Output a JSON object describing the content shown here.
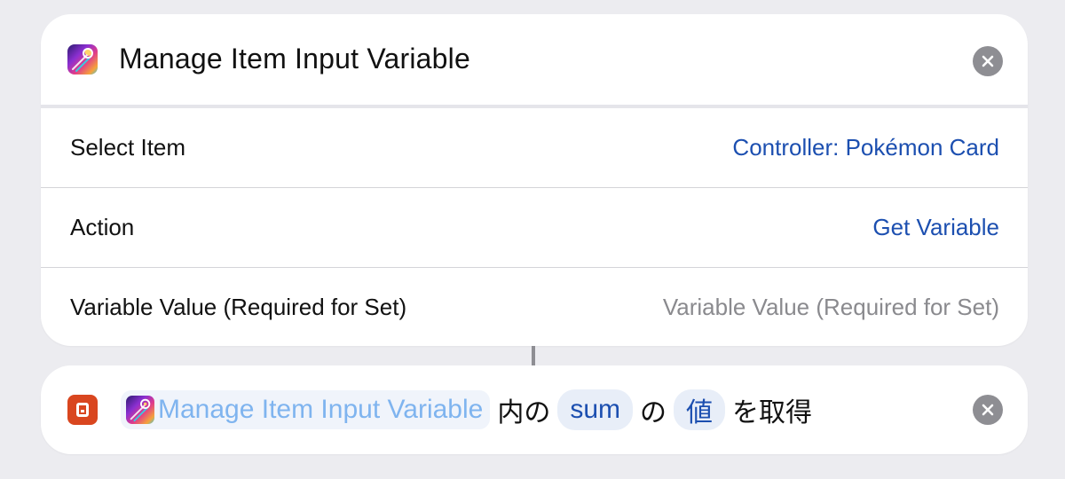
{
  "action_card": {
    "title": "Manage Item Input Variable",
    "icon": "app-gradient-icon",
    "close_icon": "close-circle-icon",
    "rows": [
      {
        "label": "Select Item",
        "value": "Controller: Pokémon Card"
      },
      {
        "label": "Action",
        "value": "Get Variable"
      },
      {
        "label": "Variable Value (Required for Set)",
        "placeholder": "Variable Value (Required for Set)"
      }
    ]
  },
  "get_variable_card": {
    "icon": "script-icon",
    "app_token_label": "Manage Item Input Variable",
    "text_in": "内の",
    "variable_name": "sum",
    "text_of": "の",
    "value_token": "値",
    "text_get": "を取得",
    "close_icon": "close-circle-icon"
  },
  "colors": {
    "background": "#ececf0",
    "accent_blue": "#1c4fb0",
    "light_blue": "#7fb4ef",
    "placeholder_gray": "#8a8a8e",
    "script_icon_orange": "#d9461f"
  }
}
